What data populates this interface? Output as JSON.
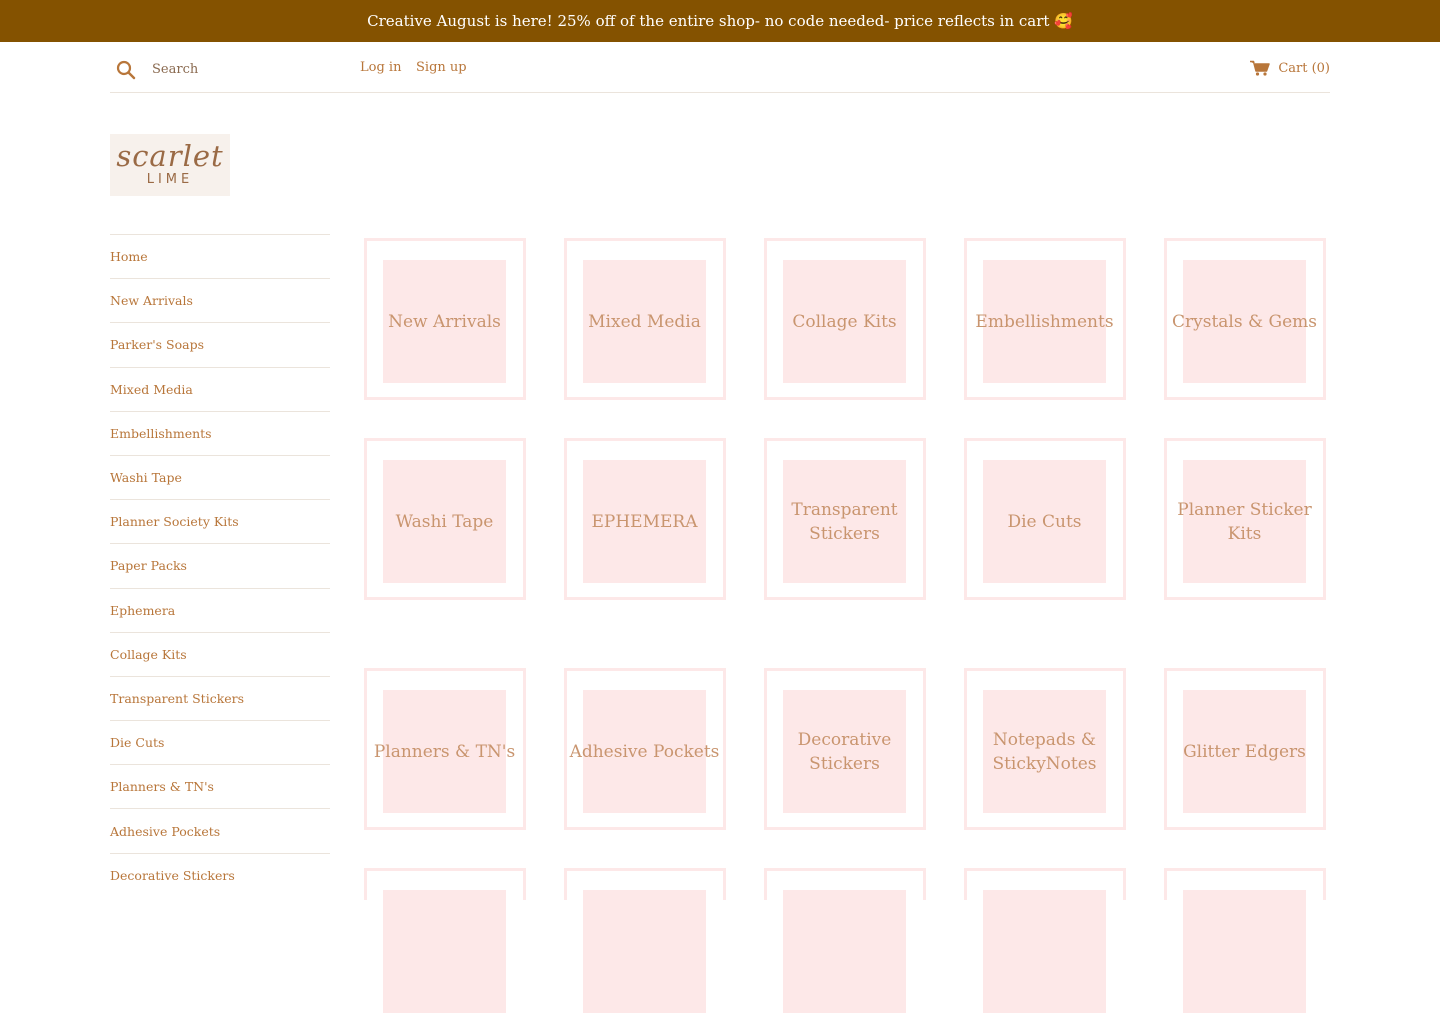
{
  "announcement": "Creative August is here! 25% off of the entire shop- no code needed- price reflects in cart 🥰",
  "header": {
    "search_placeholder": "Search",
    "login": "Log in",
    "signup": "Sign up",
    "cart": "Cart (0)"
  },
  "logo": {
    "script": "scarlet",
    "sub": "LIME"
  },
  "sidebar": {
    "items": [
      {
        "label": "Home"
      },
      {
        "label": "New Arrivals"
      },
      {
        "label": "Parker's Soaps"
      },
      {
        "label": "Mixed Media"
      },
      {
        "label": "Embellishments"
      },
      {
        "label": "Washi Tape"
      },
      {
        "label": "Planner Society Kits"
      },
      {
        "label": "Paper Packs"
      },
      {
        "label": "Ephemera"
      },
      {
        "label": "Collage Kits"
      },
      {
        "label": "Transparent Stickers"
      },
      {
        "label": "Die Cuts"
      },
      {
        "label": "Planners & TN's"
      },
      {
        "label": "Adhesive Pockets"
      },
      {
        "label": "Decorative Stickers"
      }
    ]
  },
  "collections": [
    {
      "label": "New Arrivals"
    },
    {
      "label": "Mixed Media"
    },
    {
      "label": "Collage Kits"
    },
    {
      "label": "Embellishments"
    },
    {
      "label": "Crystals & Gems"
    },
    {
      "label": "Washi Tape"
    },
    {
      "label": "EPHEMERA"
    },
    {
      "label": "Transparent Stickers"
    },
    {
      "label": "Die Cuts"
    },
    {
      "label": "Planner Sticker Kits"
    },
    {
      "label": "Planners & TN's"
    },
    {
      "label": "Adhesive Pockets"
    },
    {
      "label": "Decorative Stickers"
    },
    {
      "label": "Notepads & StickyNotes"
    },
    {
      "label": "Glitter Edgers"
    },
    {
      "label": ""
    },
    {
      "label": ""
    },
    {
      "label": ""
    },
    {
      "label": ""
    },
    {
      "label": ""
    }
  ],
  "colors": {
    "announcement_bg": "#845200",
    "accent": "#b8763a",
    "tile_pink": "#fde8e8"
  }
}
